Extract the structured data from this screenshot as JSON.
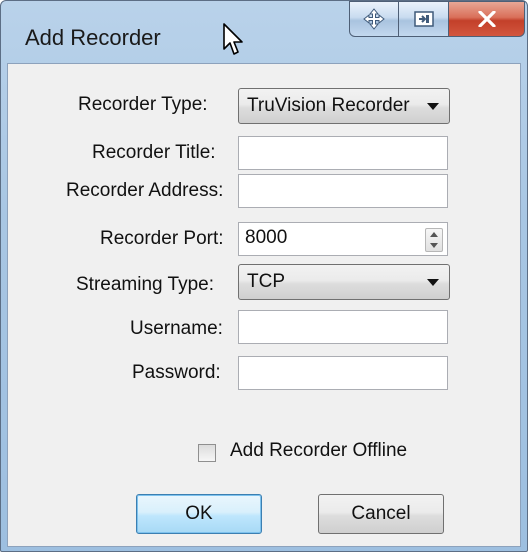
{
  "window": {
    "title": "Add Recorder",
    "caption_buttons": [
      {
        "name": "move",
        "icon": "move-arrows-icon"
      },
      {
        "name": "restore",
        "icon": "restore-icon"
      },
      {
        "name": "close",
        "icon": "close-icon",
        "label": "x"
      }
    ]
  },
  "form": {
    "recorder_type": {
      "label": "Recorder Type:",
      "value": "TruVision Recorder"
    },
    "recorder_title": {
      "label": "Recorder Title:",
      "value": ""
    },
    "recorder_address": {
      "label": "Recorder Address:",
      "value": ""
    },
    "recorder_port": {
      "label": "Recorder Port:",
      "value": "8000"
    },
    "streaming_type": {
      "label": "Streaming Type:",
      "value": "TCP"
    },
    "username": {
      "label": "Username:",
      "value": ""
    },
    "password": {
      "label": "Password:",
      "value": ""
    }
  },
  "offline_checkbox": {
    "label": "Add Recorder Offline",
    "checked": false
  },
  "buttons": {
    "ok": "OK",
    "cancel": "Cancel"
  },
  "colors": {
    "title_bar": "#a8c6e3",
    "client_bg": "#f0f0f0",
    "close_button": "#c3402a",
    "default_button_border": "#3c7fb1"
  }
}
